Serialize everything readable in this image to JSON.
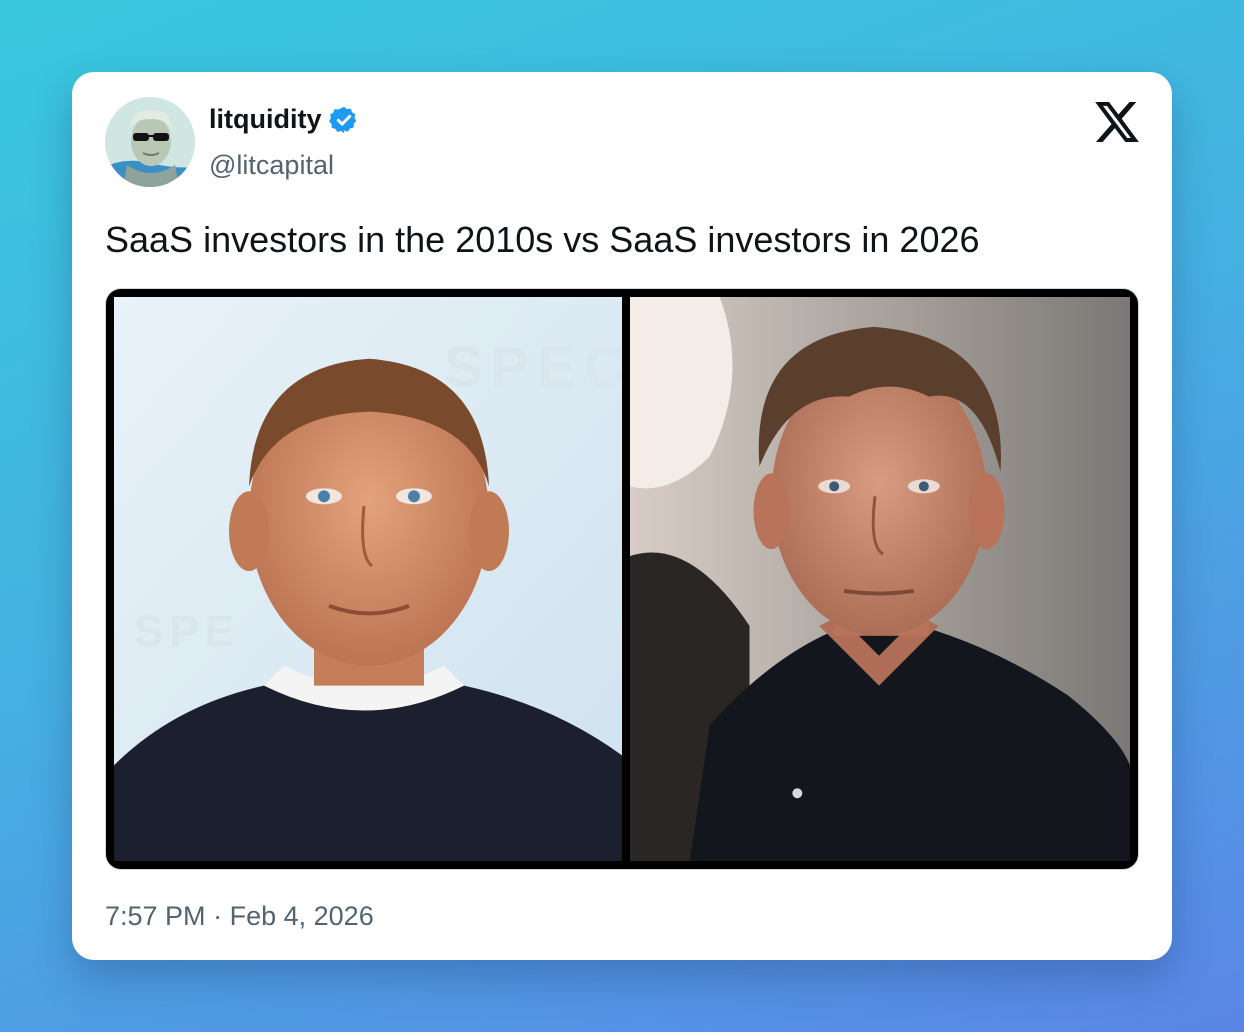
{
  "author": {
    "display_name": "litquidity",
    "handle": "@litcapital",
    "verified": true,
    "avatar_icon": "avatar-icon"
  },
  "platform_icon": "x-logo-icon",
  "tweet": {
    "text": "SaaS investors in the 2010s vs SaaS investors in 2026"
  },
  "media": {
    "left_backdrop_text": "SPECTRE",
    "left_backdrop_text_lower": "SPE"
  },
  "meta": {
    "time": "7:57 PM",
    "separator": "·",
    "date": "Feb 4, 2026"
  },
  "colors": {
    "verified_badge": "#1d9bf0",
    "text_primary": "#0f1419",
    "text_secondary": "#536471"
  }
}
